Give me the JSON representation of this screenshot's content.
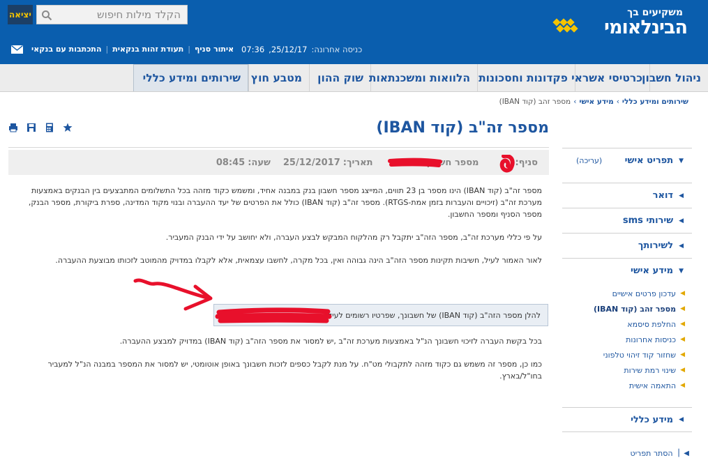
{
  "header": {
    "logo_small": "משקיעים בך",
    "logo_main": "הבינלאומי",
    "exit_label": "יציאה",
    "search_placeholder": "הקלד מילות חיפוש",
    "last_login_label": "כניסה אחרונה:",
    "last_login_date": "25/12/17,",
    "last_login_time": "07:36",
    "links": [
      "איתור סניף",
      "תעודת זהות בנקאית",
      "התכתבות עם בנקאי"
    ]
  },
  "nav": {
    "items": [
      "ניהול חשבון",
      "כרטיסי אשראי",
      "פקדונות וחסכונות",
      "הלוואות ומשכנתאות",
      "שוק ההון",
      "מטבע חוץ",
      "שירותים ומידע כללי"
    ]
  },
  "breadcrumb": [
    "שירותים ומידע כללי",
    "מידע אישי",
    "מספר זהב (קוד IBAN)"
  ],
  "page": {
    "title": "מספר זה\"ב (קוד IBAN)",
    "branch_label": "סניף:",
    "account_label": "מספר חשבון:",
    "date_label": "תאריך:",
    "date_value": "25/12/2017",
    "time_label": "שעה:",
    "time_value": "08:45"
  },
  "content": {
    "p1": "מספר זה\"ב (קוד IBAN) הינו מספר בן 23 תווים, המייצג מספר חשבון בנק במבנה אחיד, ומשמש כקוד מזהה בכל התשלומים המתבצעים בין הבנקים באמצעות מערכת זה\"ב (זיכויים והעברות בזמן אמת-RTGS). מספר זה\"ב (קוד IBAN) כולל את הפרטים של יעד ההעברה ובנוי מקוד המדינה, ספרת ביקורת, מספר הבנק, מספר הסניף ומספר החשבון.",
    "p2": "על פי כללי מערכת זה\"ב, מספר הזה\"ב יתקבל רק מהלקוח המבקש לבצע העברה, ולא יחושב על ידי הבנק המעביר.",
    "p3": "לאור האמור לעיל, חשיבות תקינות מספר הזה\"ב הינה גבוהה ואין, בכל מקרה, לחשבו עצמאית, אלא לקבלו במדויק מהמוטב לזכותו מבוצעת ההעברה.",
    "iban_box": "להלן מספר הזה\"ב (קוד IBAN) של חשבונך, שפרטיו רשומים לעיל:",
    "p4": "בכל בקשת העברה לזיכוי חשבונך הנ\"ל באמצעות מערכת זה\"ב ,יש למסור את מספר הזה\"ב (קוד IBAN) במדויק למבצע ההעברה.",
    "p5": "כמו כן, מספר זה משמש גם כקוד מזהה לתקבולי מט\"ח. על מנת לקבל כספים לזכות חשבונך באופן אוטומטי, יש למסור את המספר במבנה הנ\"ל למעביר בחו\"ל/בארץ."
  },
  "sidebar": {
    "profile": "תפריט אישי",
    "edit": "(עריכה)",
    "mail": "דואר",
    "sms": "שירותי sms",
    "for_you": "לשירותך",
    "personal_info": "מידע אישי",
    "sub_items": [
      "עדכון פרטים אישיים",
      "מספר זהב (קוד IBAN)",
      "החלפת סיסמא",
      "כניסות אחרונות",
      "שחזור קוד זיהוי טלפוני",
      "שינוי רמת שירות",
      "התאמה אישית"
    ],
    "general_info": "מידע כללי",
    "hide_menu": "הסתר תפריט"
  },
  "colors": {
    "header_blue": "#0a5eae",
    "accent_yellow": "#f5c400",
    "link_blue": "#1e56a0",
    "annotation_red": "#e8102b"
  }
}
